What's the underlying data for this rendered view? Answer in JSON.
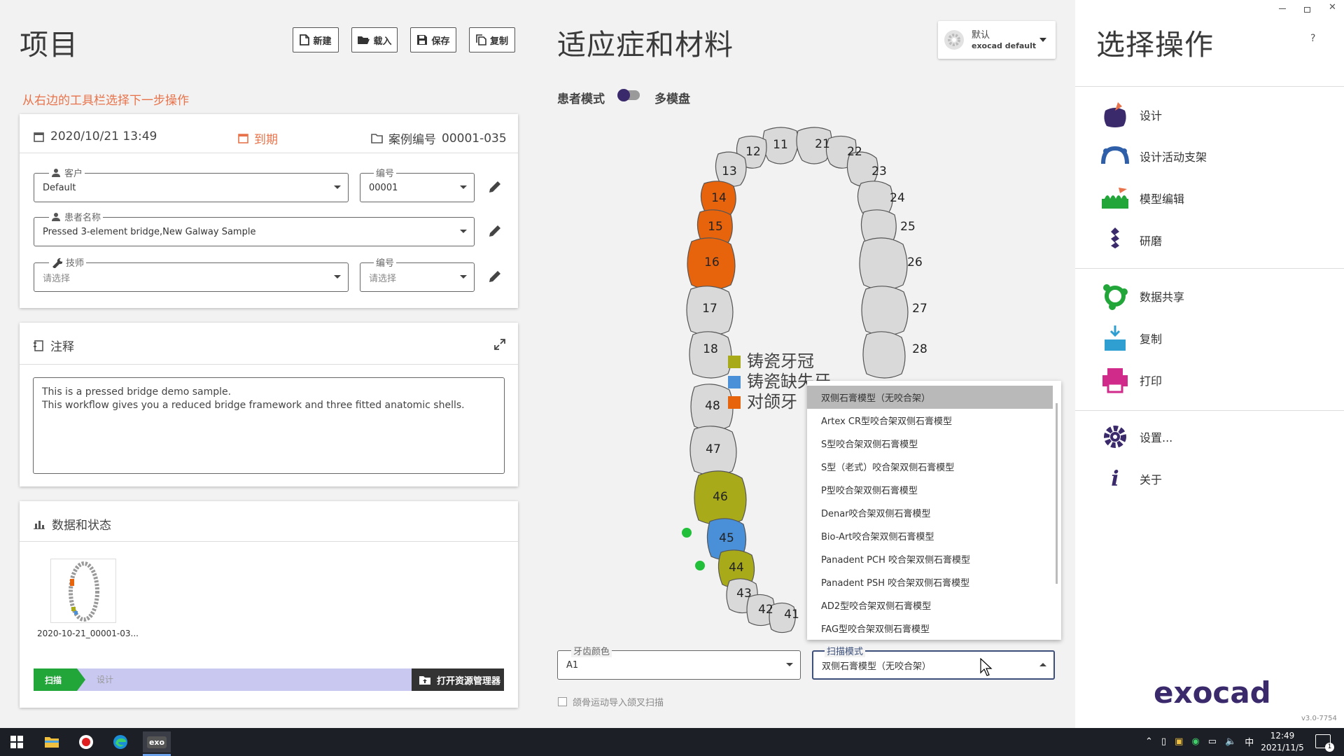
{
  "left": {
    "title": "项目",
    "toolbar": {
      "new": "新建",
      "load": "载入",
      "save": "保存",
      "copy": "复制"
    },
    "hint": "从右边的工具栏选择下一步操作",
    "info": {
      "date": "2020/10/21 13:49",
      "due": "到期",
      "case_label": "案例编号",
      "case_no": "00001-035",
      "customer_label": "客户",
      "customer_value": "Default",
      "num1_label": "编号",
      "num1_value": "00001",
      "patient_label": "患者名称",
      "patient_value": "Pressed 3-element bridge,New Galway Sample",
      "tech_label": "技师",
      "tech_value": "请选择",
      "num2_label": "编号",
      "num2_value": "请选择"
    },
    "notes": {
      "title": "注释",
      "text": "This is a pressed bridge demo sample.\nThis workflow gives you a reduced bridge framework and three fitted anatomic shells."
    },
    "status": {
      "title": "数据和状态",
      "thumb_label": "2020-10-21_00001-03...",
      "step_scan": "扫描",
      "step_design": "设计",
      "open_explorer": "打开资源管理器"
    }
  },
  "middle": {
    "title": "适应症和材料",
    "profile": {
      "line1": "默认",
      "line2": "exocad default"
    },
    "toggle_left": "患者模式",
    "toggle_right": "多模盘",
    "legend": [
      {
        "label": "铸瓷牙冠",
        "color": "#a8aa1a"
      },
      {
        "label": "铸瓷缺失牙",
        "color": "#4a90d9"
      },
      {
        "label": "对颌牙",
        "color": "#e8640c"
      }
    ],
    "teeth": {
      "upper": [
        "11",
        "12",
        "13",
        "14",
        "15",
        "16",
        "17",
        "18",
        "21",
        "22",
        "23",
        "24",
        "25",
        "26",
        "27",
        "28"
      ],
      "lower": [
        "41",
        "42",
        "43",
        "44",
        "45",
        "46",
        "47",
        "48"
      ]
    },
    "shade_label": "牙齿颜色",
    "shade_value": "A1",
    "scan_label": "扫描模式",
    "scan_value": "双侧石膏模型（无咬合架）",
    "checkbox_label": "颌骨运动导入颌叉扫描",
    "dropdown_options": [
      "双侧石膏模型（无咬合架）",
      "Artex CR型咬合架双侧石膏模型",
      "S型咬合架双侧石膏模型",
      "S型（老式）咬合架双侧石膏模型",
      "P型咬合架双侧石膏模型",
      "Denar咬合架双侧石膏模型",
      "Bio-Art咬合架双侧石膏模型",
      "Panadent PCH 咬合架双侧石膏模型",
      "Panadent PSH 咬合架双侧石膏模型",
      "AD2型咬合架双侧石膏模型",
      "FAG型咬合架双侧石膏模型"
    ]
  },
  "right": {
    "title": "选择操作",
    "help": "?",
    "items": [
      "设计",
      "设计活动支架",
      "模型编辑",
      "研磨",
      "数据共享",
      "复制",
      "打印",
      "设置...",
      "关于"
    ],
    "brand": "exocad",
    "version": "v3.0-7754"
  },
  "taskbar": {
    "ime": "中",
    "time": "12:49",
    "date": "2021/11/5",
    "notif": "1"
  },
  "colors": {
    "accent_orange": "#e8734a",
    "scan_green": "#22a63a",
    "design_lilac": "#c9c8f0",
    "dark_btn": "#333"
  }
}
